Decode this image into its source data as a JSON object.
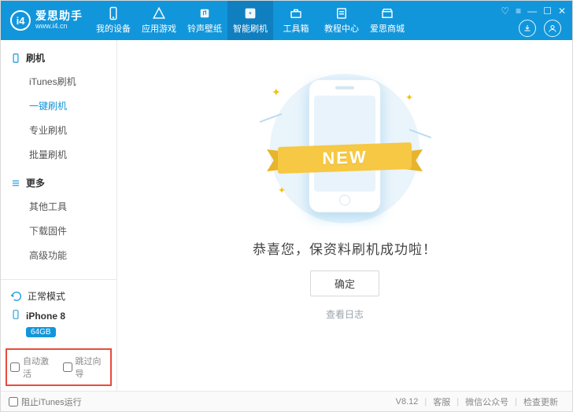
{
  "logo": {
    "name": "爱思助手",
    "url": "www.i4.cn",
    "badge": "i4"
  },
  "nav": {
    "items": [
      {
        "label": "我的设备",
        "icon": "device"
      },
      {
        "label": "应用游戏",
        "icon": "apps"
      },
      {
        "label": "铃声壁纸",
        "icon": "music"
      },
      {
        "label": "智能刷机",
        "icon": "flash"
      },
      {
        "label": "工具箱",
        "icon": "toolbox"
      },
      {
        "label": "教程中心",
        "icon": "book"
      },
      {
        "label": "爱思商城",
        "icon": "store"
      }
    ],
    "active_index": 3
  },
  "sidebar": {
    "groups": [
      {
        "title": "刷机",
        "icon": "phone",
        "items": [
          "iTunes刷机",
          "一键刷机",
          "专业刷机",
          "批量刷机"
        ],
        "active_index": 1
      },
      {
        "title": "更多",
        "icon": "menu",
        "items": [
          "其他工具",
          "下载固件",
          "高级功能"
        ],
        "active_index": -1
      }
    ],
    "mode_label": "正常模式",
    "device": {
      "name": "iPhone 8",
      "storage": "64GB"
    },
    "check_auto_activate": "自动激活",
    "check_skip_wizard": "跳过向导"
  },
  "main": {
    "ribbon_text": "NEW",
    "success_text": "恭喜您，保资料刷机成功啦！",
    "ok_button": "确定",
    "log_link": "查看日志"
  },
  "footer": {
    "block_itunes": "阻止iTunes运行",
    "version": "V8.12",
    "support": "客服",
    "wechat": "微信公众号",
    "update": "检查更新"
  }
}
